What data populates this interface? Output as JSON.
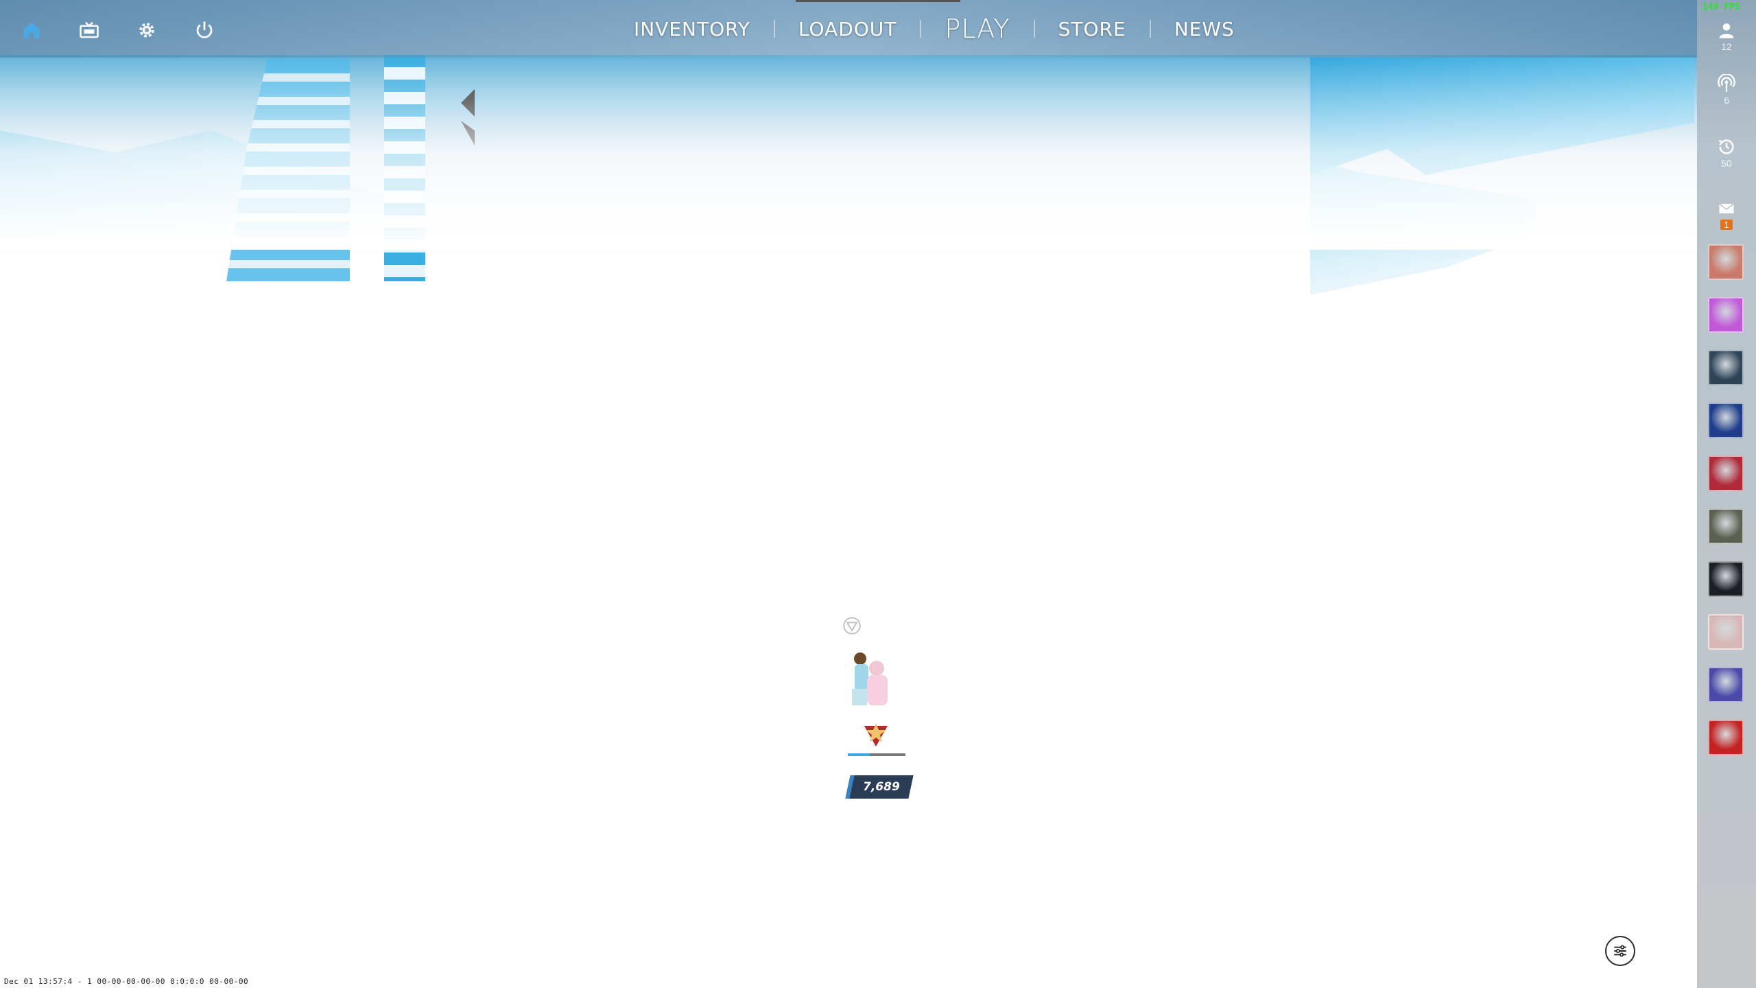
{
  "top_icons": [
    {
      "name": "home-icon",
      "color": "#48a9e6"
    },
    {
      "name": "tv-icon",
      "color": "#ffffff"
    },
    {
      "name": "settings-gear-icon",
      "color": "#ffffff"
    },
    {
      "name": "power-icon",
      "color": "#ffffff"
    }
  ],
  "nav": {
    "inventory": "INVENTORY",
    "loadout": "LOADOUT",
    "play": "PLAY",
    "store": "STORE",
    "news": "NEWS",
    "active": "PLAY"
  },
  "rail": {
    "fps": "149 FPS",
    "online_friends": "12",
    "broadcasts": "6",
    "recent_players": "50",
    "mail_count": "1",
    "friends": [
      {
        "name": "friend-avatar-1",
        "color": "#c97a6a"
      },
      {
        "name": "friend-avatar-2",
        "color": "#c15ad8"
      },
      {
        "name": "friend-avatar-3",
        "color": "#2e4458"
      },
      {
        "name": "friend-avatar-4",
        "color": "#1f3d8a"
      },
      {
        "name": "friend-avatar-5",
        "color": "#b02a3a"
      },
      {
        "name": "friend-avatar-6",
        "color": "#5b6051"
      },
      {
        "name": "friend-avatar-7",
        "color": "#1a1d22"
      },
      {
        "name": "friend-avatar-8",
        "color": "#d8b7b7"
      },
      {
        "name": "friend-avatar-9",
        "color": "#4b4aa8"
      },
      {
        "name": "friend-avatar-10",
        "color": "#c22222"
      }
    ]
  },
  "party": {
    "points": "7,689",
    "rank_progress": 0.38
  },
  "status_line": "Dec 01 13:57:4 - 1 00-00-00-00-00 0:0:0:0 00-00-00"
}
